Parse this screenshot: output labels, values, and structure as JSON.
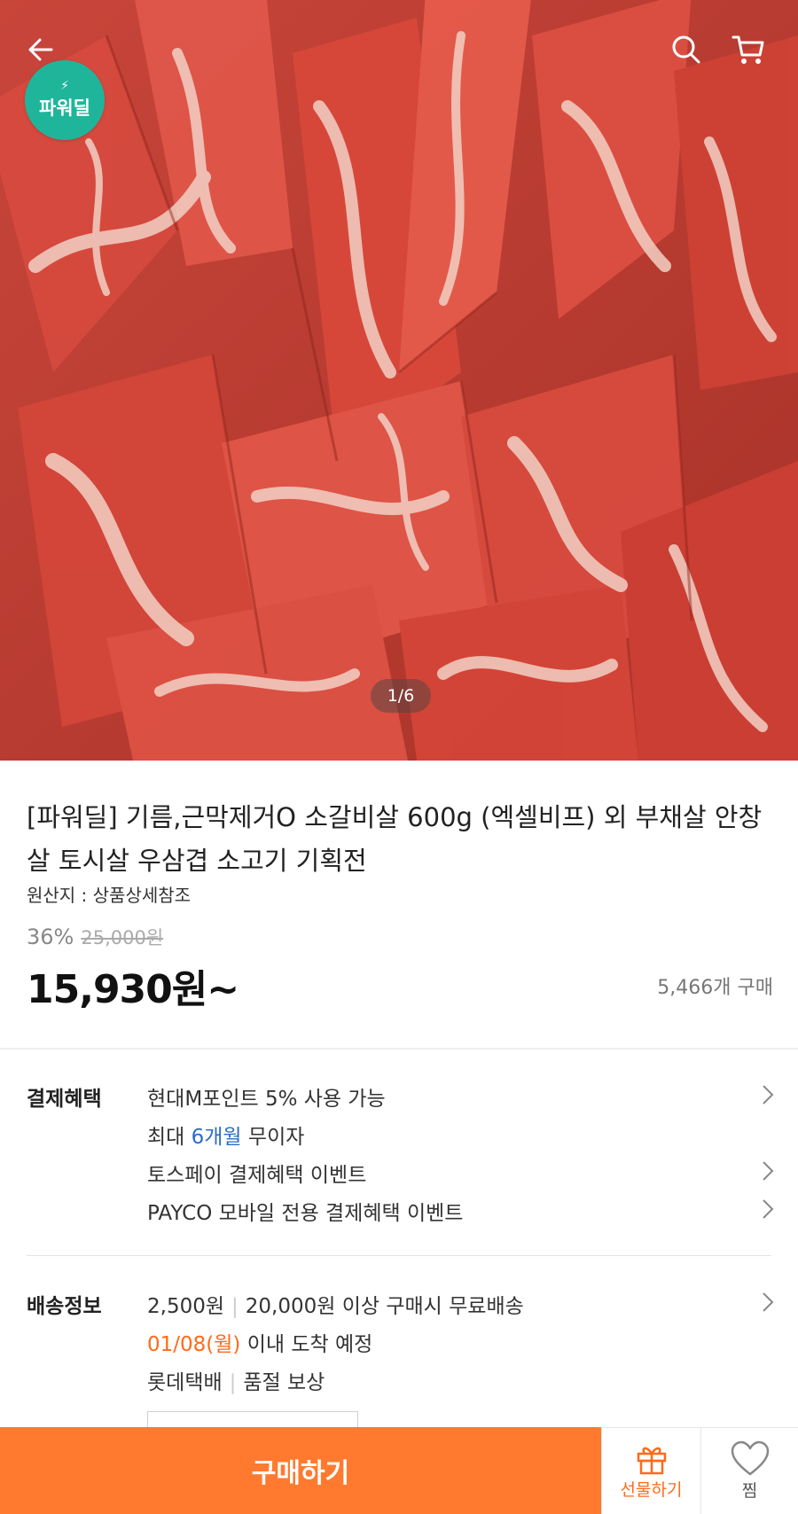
{
  "hero": {
    "image_label": "meat-product-photo",
    "badge_text": "파워딜",
    "pager": "1/6"
  },
  "icons": {
    "back": "arrow-left-icon",
    "search": "search-icon",
    "cart": "cart-icon",
    "gift": "gift-icon",
    "wish": "heart-icon"
  },
  "product": {
    "title": "[파워딜] 기름,근막제거O 소갈비살 600g (엑셀비프) 외 부채살 안창살 토시살 우삼겹 소고기 기획전",
    "origin": "원산지 : 상품상세참조",
    "discount": "36%",
    "original_price": "25,000원",
    "price": "15,930원~",
    "sold_count": "5,466개 구매"
  },
  "payment": {
    "heading": "결제혜택",
    "line1": "현대M포인트 5% 사용 가능",
    "line2_prefix": "최대",
    "line2_highlight": "6개월",
    "line2_suffix": "무이자",
    "line3": "토스페이 결제혜택 이벤트",
    "line4": "PAYCO 모바일 전용 결제혜택 이벤트"
  },
  "shipping": {
    "heading": "배송정보",
    "fee": "2,500원",
    "free_condition": "20,000원 이상 구매시 무료배송",
    "arrival_date": "01/08(월)",
    "arrival_suffix": "이내 도착 예정",
    "carrier": "롯데택배",
    "guarantee": "품절 보상"
  },
  "bottom_bar": {
    "buy_label": "구매하기",
    "gift_label": "선물하기",
    "wish_label": "찜"
  },
  "colors": {
    "accent_orange": "#ff7a2e",
    "badge_green": "#1fb59b",
    "link_blue": "#2a6cc4"
  }
}
